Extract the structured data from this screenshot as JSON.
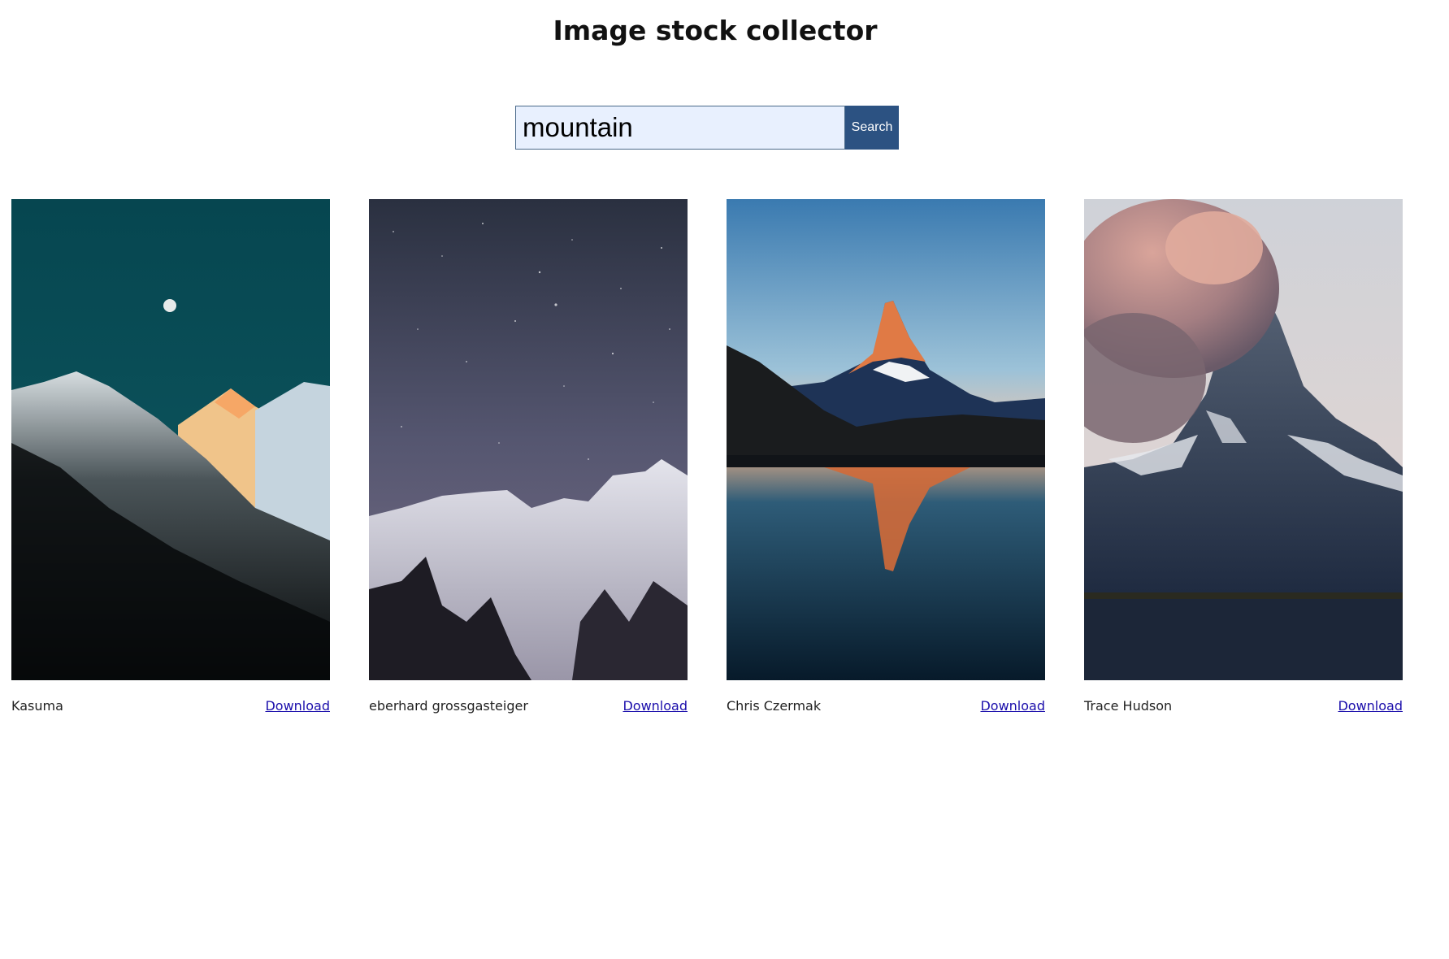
{
  "header": {
    "title": "Image stock collector"
  },
  "search": {
    "value": "mountain",
    "button_label": "Search"
  },
  "results": [
    {
      "author": "Kasuma",
      "download_label": "Download",
      "scene": "mountain-moon-dusk-photo"
    },
    {
      "author": "eberhard grossgasteiger",
      "download_label": "Download",
      "scene": "snowy-ridge-starry-sky-photo"
    },
    {
      "author": "Chris Czermak",
      "download_label": "Download",
      "scene": "matterhorn-lake-reflection-photo"
    },
    {
      "author": "Trace Hudson",
      "download_label": "Download",
      "scene": "peak-with-clouds-photo"
    }
  ],
  "colors": {
    "search_button": "#2c5282",
    "search_input_bg": "#e8f0fe",
    "link": "#1a0dab"
  }
}
